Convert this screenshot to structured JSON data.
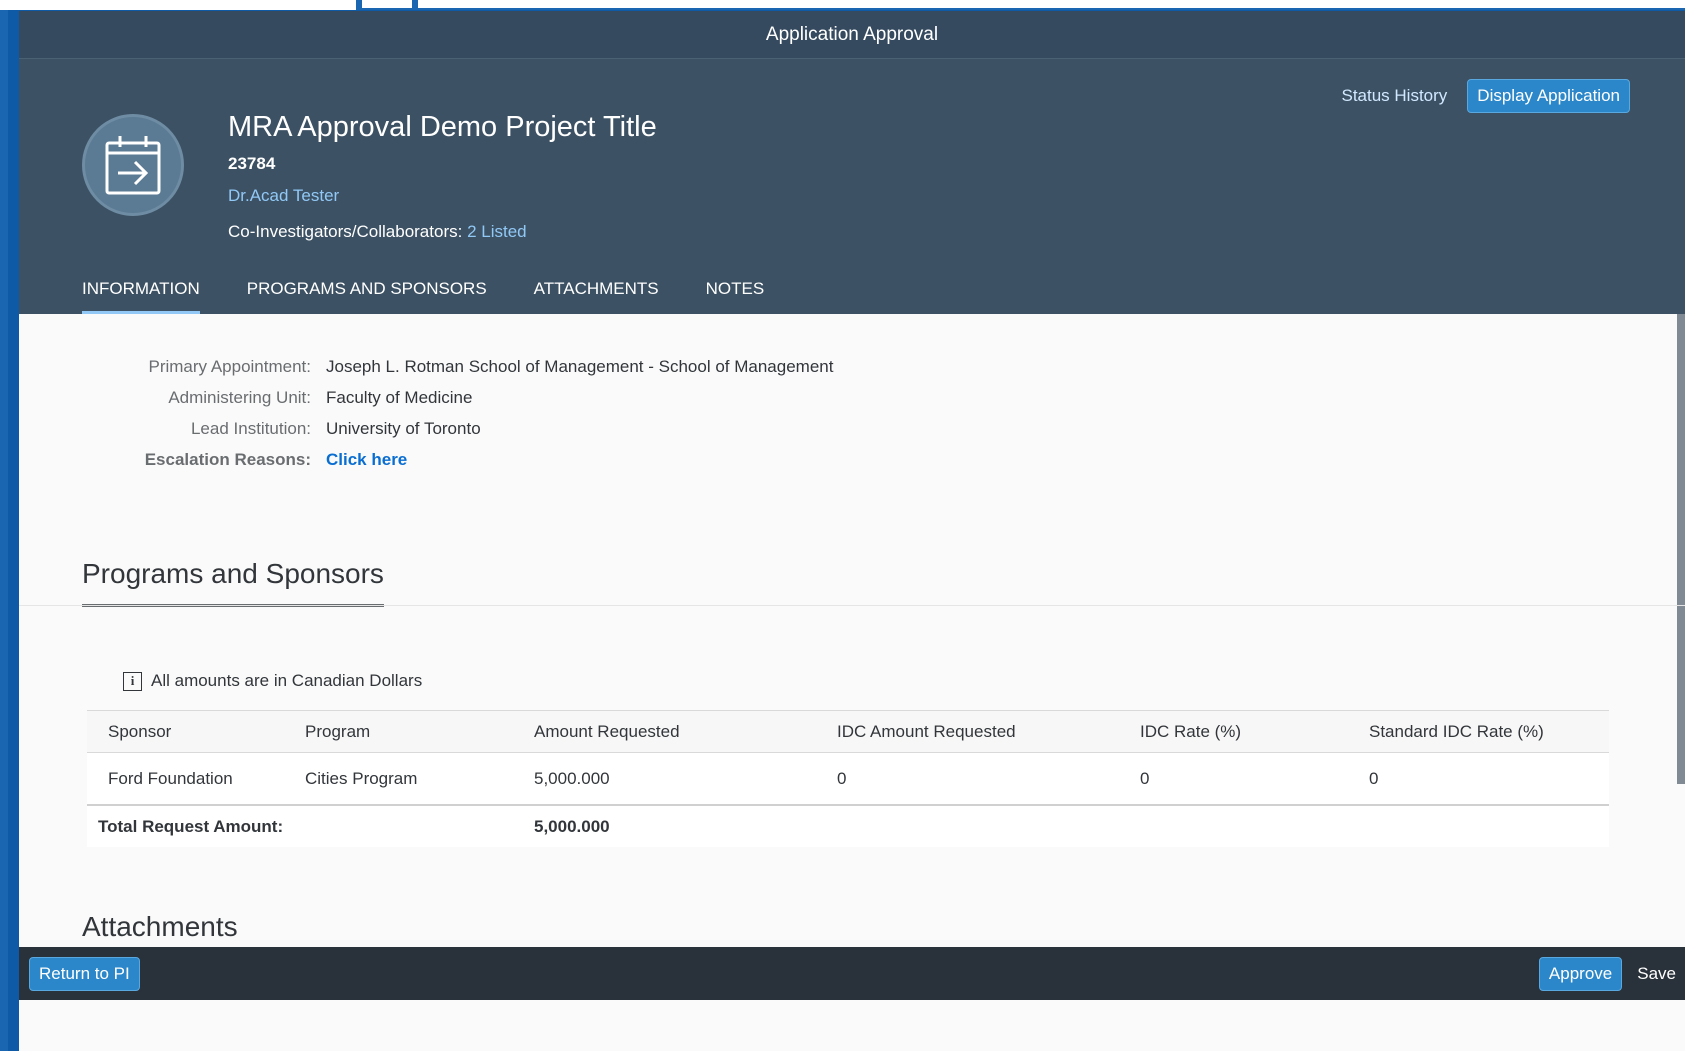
{
  "window": {
    "title": "Application Approval"
  },
  "header": {
    "status_history": "Status History",
    "display_application": "Display Application",
    "title": "MRA Approval Demo Project Title",
    "number": "23784",
    "person": "Dr.Acad Tester",
    "coinvestigators_label": "Co-Investigators/Collaborators:",
    "coinvestigators_link": "2 Listed",
    "avatar_icon": "calendar-arrow-icon"
  },
  "tabs": [
    {
      "label": "INFORMATION",
      "active": true
    },
    {
      "label": "PROGRAMS AND SPONSORS",
      "active": false
    },
    {
      "label": "ATTACHMENTS",
      "active": false
    },
    {
      "label": "NOTES",
      "active": false
    }
  ],
  "information": {
    "rows": [
      {
        "label": "Primary Appointment:",
        "value": "Joseph L. Rotman School of Management - School of Management"
      },
      {
        "label": "Administering Unit:",
        "value": "Faculty of Medicine"
      },
      {
        "label": "Lead Institution:",
        "value": "University of Toronto"
      },
      {
        "label": "Escalation Reasons:",
        "value": "Click here"
      }
    ]
  },
  "programs": {
    "section_title": "Programs and Sponsors",
    "note": "All amounts are in Canadian Dollars",
    "columns": [
      "Sponsor",
      "Program",
      "Amount Requested",
      "IDC Amount Requested",
      "IDC Rate (%)",
      "Standard IDC Rate (%)"
    ],
    "rows": [
      [
        "Ford Foundation",
        "Cities Program",
        "5,000.000",
        "0",
        "0",
        "0"
      ]
    ],
    "total_label": "Total Request Amount:",
    "total_value": "5,000.000"
  },
  "attachments": {
    "section_title": "Attachments"
  },
  "footer": {
    "return_to_pi": "Return to PI",
    "approve": "Approve",
    "save": "Save"
  },
  "colors": {
    "shell_header": "#354a5f",
    "object_header": "#3c5163",
    "accent": "#2b87c9",
    "link": "#0a6ed1"
  }
}
